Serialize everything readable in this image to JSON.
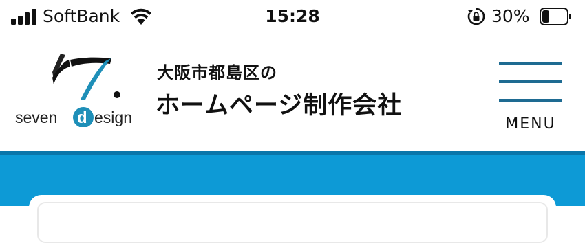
{
  "status_bar": {
    "carrier": "SoftBank",
    "time": "15:28",
    "battery_percent": "30%",
    "icons": [
      "signal-icon",
      "wifi-icon",
      "rotation-lock-icon",
      "battery-icon"
    ]
  },
  "header": {
    "logo": {
      "text_prefix": "seven",
      "text_highlight": "d",
      "text_suffix": "esign",
      "accent_color": "#1e8fb8"
    },
    "tagline": "大阪市都島区の",
    "site_name": "ホームページ制作会社",
    "menu_label": "MENU"
  },
  "colors": {
    "menu_lines": "#1e6b92",
    "hero_band": "#0d9ad6",
    "hero_band_border": "#0a76aa"
  }
}
